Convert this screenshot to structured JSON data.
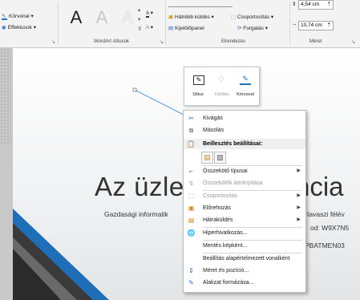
{
  "ribbon": {
    "shape_styles": {
      "outline_label": "Körvonal",
      "effects_label": "Effektusok"
    },
    "wordart": {
      "group_label": "WordArt stílusok",
      "letter": "A"
    },
    "arrange": {
      "group_label": "Elrendezés",
      "bring_forward_label": "Hátrébb küldés",
      "group_btn_label": "Csoportosítás",
      "selection_pane_label": "Kijelölőpanel",
      "rotate_label": "Forgatás"
    },
    "size": {
      "group_label": "Méret",
      "height_value": "4,54 cm",
      "width_value": "10,74 cm"
    }
  },
  "slide": {
    "title_left": "Az üzlet",
    "title_right": "ncia",
    "subtitle_left": "Gazdasági informatik",
    "subtitle_right_1": "tavaszi félév",
    "subtitle_right_2": "od: W9X7N5",
    "subtitle_right_3": "PBATMEN03"
  },
  "mini_toolbar": {
    "style_label": "Stílus",
    "fill_label": "Kitöltés",
    "outline_label": "Körvonal"
  },
  "context_menu": {
    "cut": "Kivágás",
    "copy": "Másolás",
    "paste_options": "Beillesztés beállításai:",
    "connector_types": "Összekötő típusai",
    "reroute_connectors": "Összekötők átirányítása",
    "group": "Csoportosítás",
    "bring_to_front": "Előrehozás",
    "send_to_back": "Hátraküldés",
    "hyperlink": "Hiperhivatkozás...",
    "save_as_picture": "Mentés képként...",
    "set_default_line": "Beállítás alapértelmezett vonalként",
    "size_and_position": "Méret és pozíció...",
    "format_shape": "Alakzat formázása..."
  }
}
